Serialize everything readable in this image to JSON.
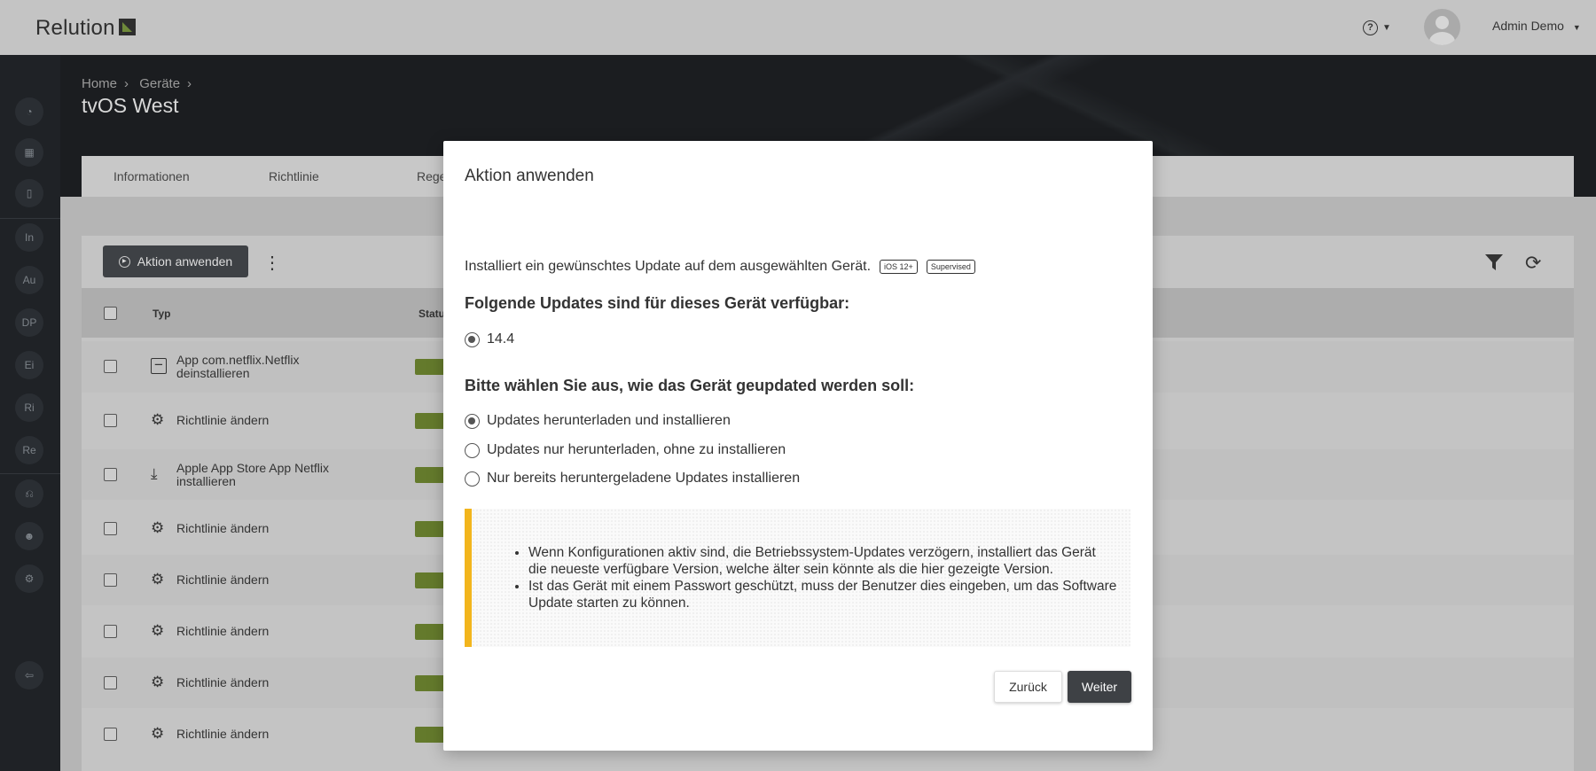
{
  "header": {
    "logo_text": "Relution",
    "help_label": "?",
    "user_name": "Admin Demo"
  },
  "sidebar": {
    "items": [
      "In",
      "Au",
      "DP",
      "Ei",
      "Ri",
      "Re"
    ]
  },
  "page": {
    "breadcrumb": [
      "Home",
      "Geräte"
    ],
    "title": "tvOS West",
    "tabs": [
      "Informationen",
      "Richtlinie",
      "Rege"
    ]
  },
  "toolbar": {
    "apply_action_label": "Aktion anwenden"
  },
  "table": {
    "columns": [
      "Typ",
      "Status"
    ],
    "rows": [
      {
        "icon": "uninstall-icon",
        "text": "App com.netflix.Netflix deinstallieren"
      },
      {
        "icon": "policy-gear-icon",
        "text": "Richtlinie ändern"
      },
      {
        "icon": "install-icon",
        "text": "Apple App Store App Netflix installieren"
      },
      {
        "icon": "policy-gear-icon",
        "text": "Richtlinie ändern"
      },
      {
        "icon": "policy-gear-icon",
        "text": "Richtlinie ändern"
      },
      {
        "icon": "policy-gear-icon",
        "text": "Richtlinie ändern"
      },
      {
        "icon": "policy-gear-icon",
        "text": "Richtlinie ändern"
      },
      {
        "icon": "policy-gear-icon",
        "text": "Richtlinie ändern"
      }
    ]
  },
  "modal": {
    "title": "Aktion anwenden",
    "description": "Installiert ein gewünschtes Update auf dem ausgewählten Gerät.",
    "badges": [
      "iOS 12+",
      "Supervised"
    ],
    "updates_heading": "Folgende Updates sind für dieses Gerät verfügbar:",
    "update_version": "14.4",
    "mode_heading": "Bitte wählen Sie aus, wie das Gerät geupdated werden soll:",
    "options": [
      "Updates herunterladen und installieren",
      "Updates nur herunterladen, ohne zu installieren",
      "Nur bereits heruntergeladene Updates installieren"
    ],
    "selected_option_index": 0,
    "notes": [
      "Wenn Konfigurationen aktiv sind, die Betriebssystem-Updates verzögern, installiert das Gerät die neueste verfügbare Version, welche älter sein könnte als die hier gezeigte Version.",
      "Ist das Gerät mit einem Passwort geschützt, muss der Benutzer dies eingeben, um das Software Update starten zu können."
    ],
    "back_label": "Zurück",
    "next_label": "Weiter"
  },
  "colors": {
    "note_accent": "#f2b51d",
    "primary_button": "#3e4145",
    "status_green": "#647a2c"
  }
}
